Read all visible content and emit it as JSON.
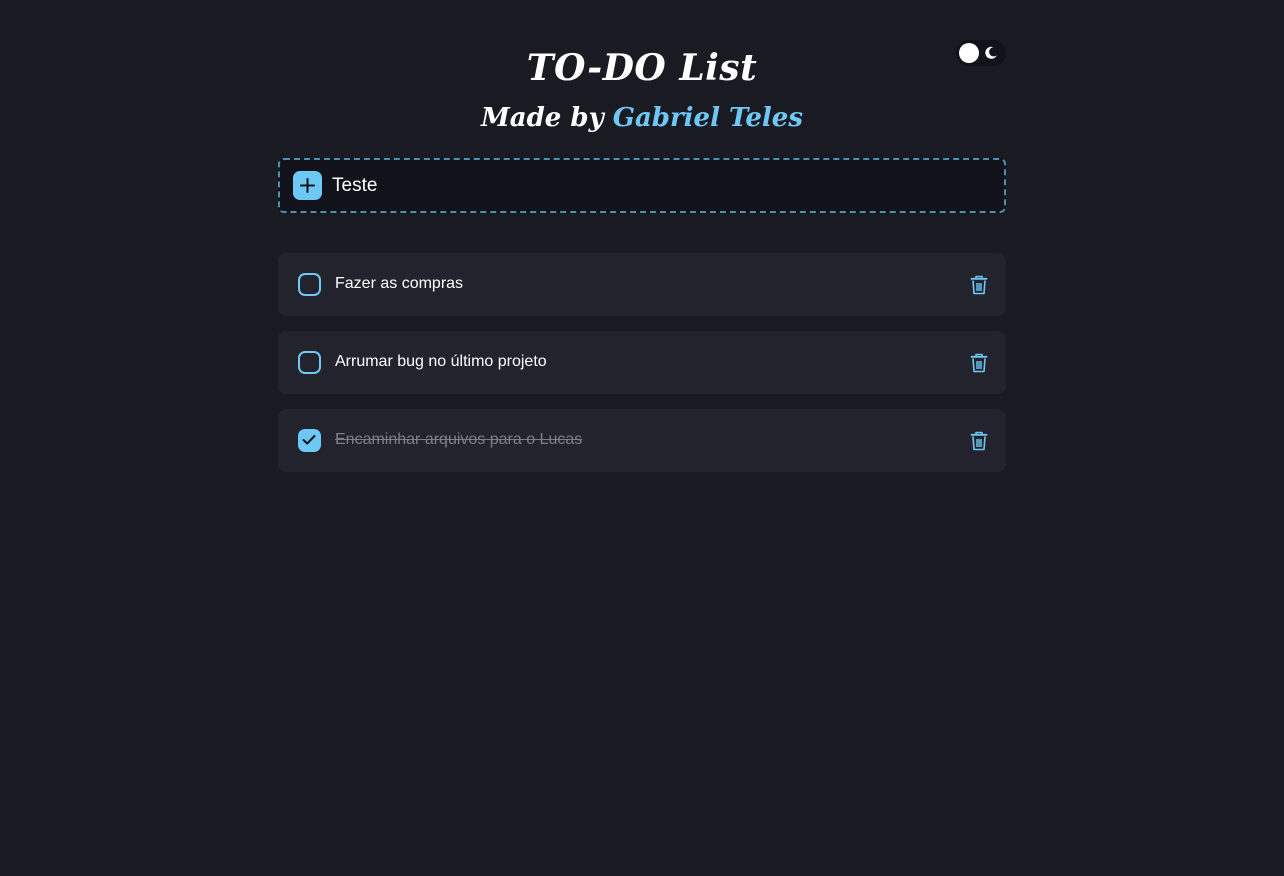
{
  "header": {
    "title": "TO-DO List",
    "subtitle_prefix": "Made by",
    "subtitle_author": "Gabriel Teles"
  },
  "theme_toggle": {
    "mode": "dark",
    "knob_icon": "circle-icon",
    "mode_icon": "moon-icon"
  },
  "add_task": {
    "button_icon": "plus-icon",
    "input_value": "Teste"
  },
  "tasks": [
    {
      "text": "Fazer as compras",
      "completed": false
    },
    {
      "text": "Arrumar bug no último projeto",
      "completed": false
    },
    {
      "text": "Encaminhar arquivos para o Lucas",
      "completed": true
    }
  ],
  "colors": {
    "background": "#191a22",
    "card": "#22232c",
    "accent": "#6ec8f5",
    "dashed_border": "#4c8fb0",
    "completed_text": "#7d7f88"
  }
}
